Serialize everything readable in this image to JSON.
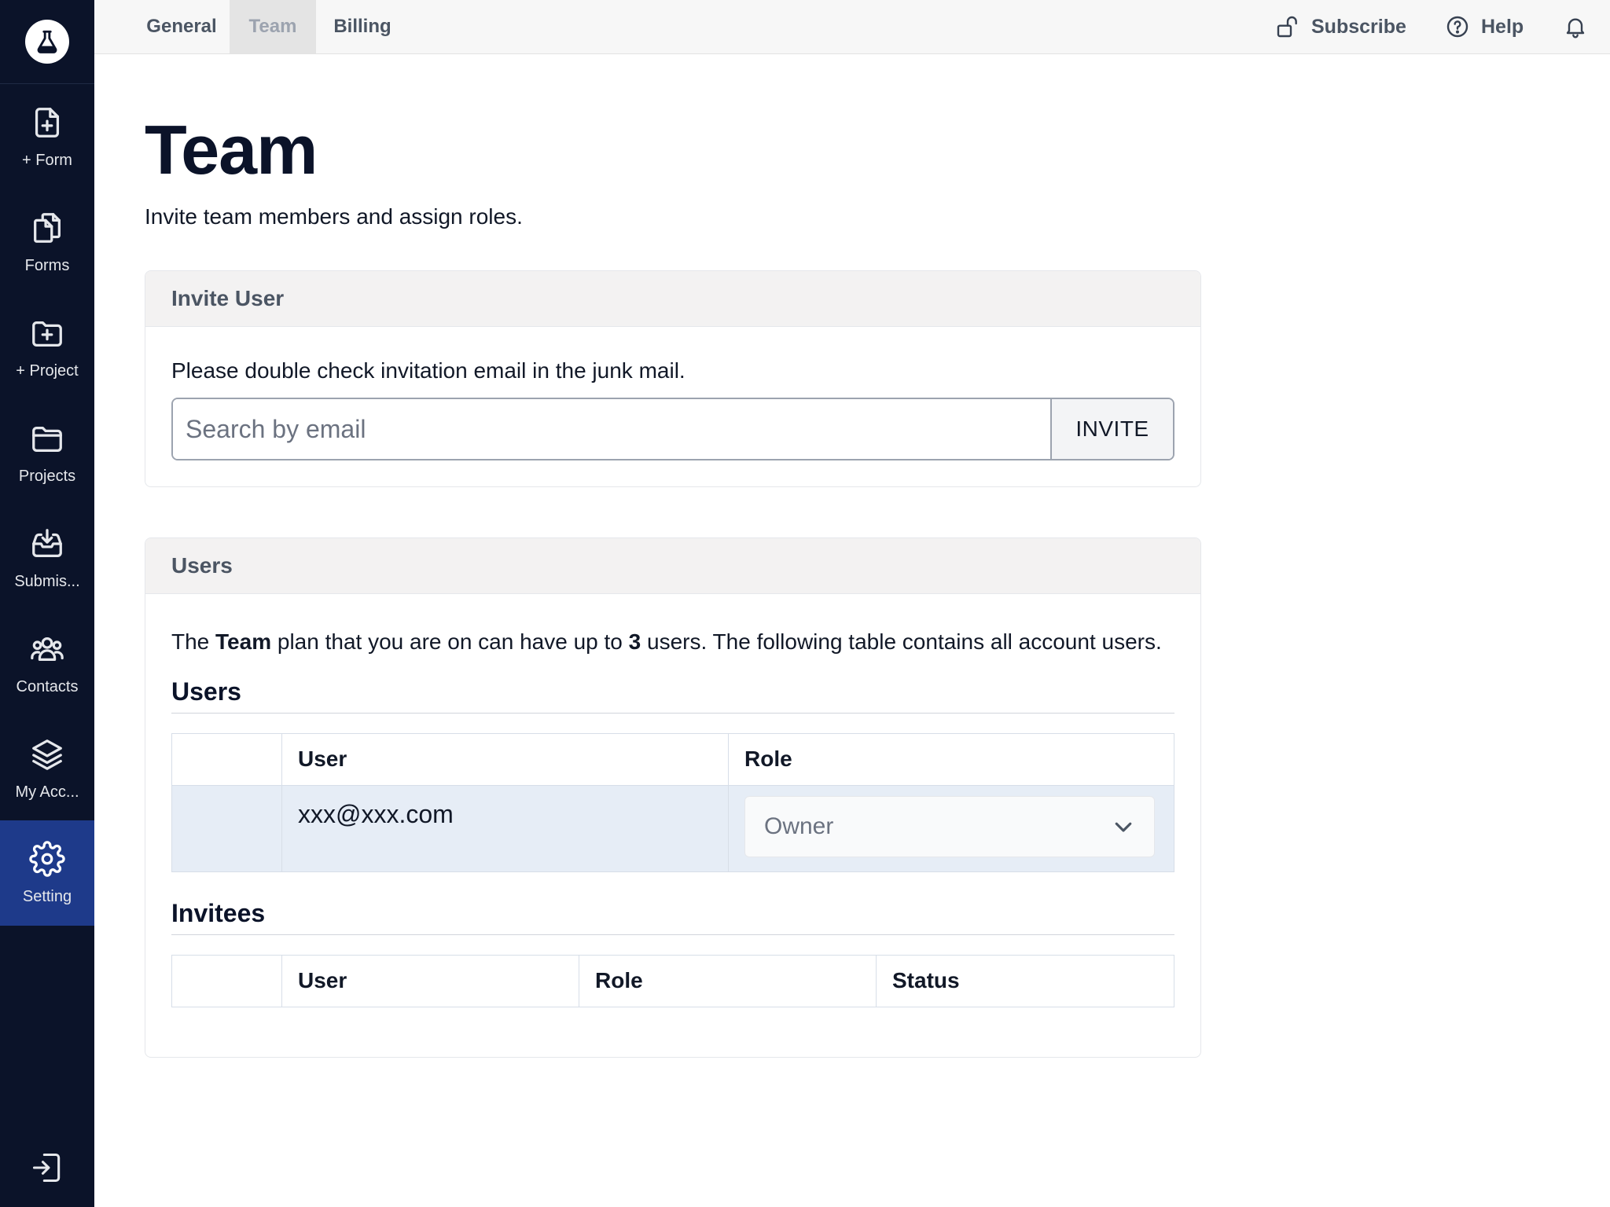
{
  "sidebar": {
    "logo": "flask-icon",
    "items": [
      {
        "label": "+ Form",
        "icon": "file-plus-icon"
      },
      {
        "label": "Forms",
        "icon": "files-icon"
      },
      {
        "label": "+ Project",
        "icon": "folder-plus-icon"
      },
      {
        "label": "Projects",
        "icon": "folder-icon"
      },
      {
        "label": "Submis...",
        "icon": "inbox-download-icon"
      },
      {
        "label": "Contacts",
        "icon": "users-icon"
      },
      {
        "label": "My Acc...",
        "icon": "layers-icon"
      },
      {
        "label": "Setting",
        "icon": "gear-icon",
        "active": true
      }
    ],
    "logout_icon": "logout-icon"
  },
  "topbar": {
    "tabs": [
      {
        "label": "General"
      },
      {
        "label": "Team",
        "active": true
      },
      {
        "label": "Billing"
      }
    ],
    "subscribe_label": "Subscribe",
    "help_label": "Help"
  },
  "page": {
    "title": "Team",
    "subtitle": "Invite team members and assign roles."
  },
  "invite_card": {
    "header": "Invite User",
    "note": "Please double check invitation email in the junk mail.",
    "email_placeholder": "Search by email",
    "invite_label": "INVITE"
  },
  "users_card": {
    "header": "Users",
    "desc_part1": "The ",
    "plan_name": "Team",
    "desc_part2": " plan that you are on can have up to ",
    "max_users": "3",
    "desc_part3": " users. The following table contains all account users.",
    "users_section_title": "Users",
    "users_columns": [
      "",
      "User",
      "Role"
    ],
    "users_rows": [
      {
        "email": "xxx@xxx.com",
        "role": "Owner"
      }
    ],
    "invitees_section_title": "Invitees",
    "invitees_columns": [
      "",
      "User",
      "Role",
      "Status"
    ]
  },
  "colors": {
    "sidebar_bg": "#0b1329",
    "active_nav_bg": "#1e3a8a",
    "row_highlight": "#e6edf6"
  }
}
